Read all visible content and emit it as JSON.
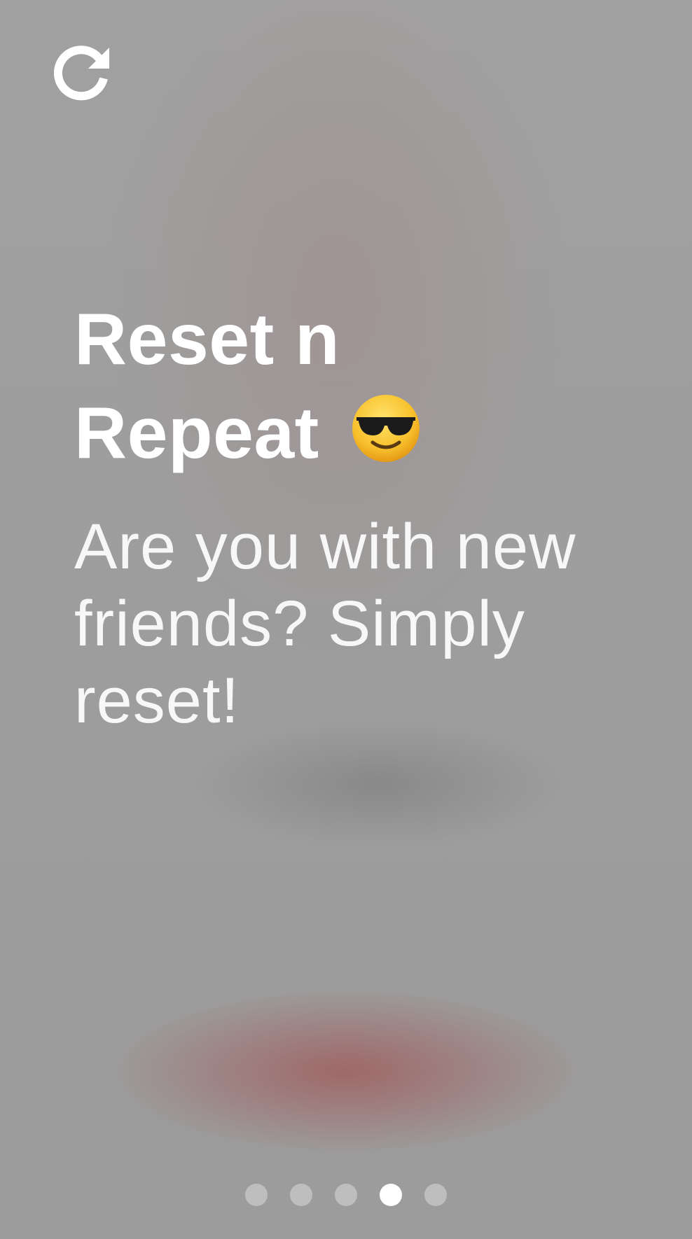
{
  "header": {
    "reset_icon": "refresh-icon"
  },
  "slide": {
    "title": "Reset n Repeat",
    "title_emoji": "smiling-face-with-sunglasses-icon",
    "subtitle": "Are you with new friends? Simply reset!"
  },
  "pager": {
    "total": 5,
    "active_index": 3
  },
  "colors": {
    "background": "#9d9d9d",
    "text": "#ffffff",
    "accent_blur": "#a05f5f",
    "dot_inactive": "rgba(255,255,255,0.35)",
    "dot_active": "#ffffff"
  }
}
